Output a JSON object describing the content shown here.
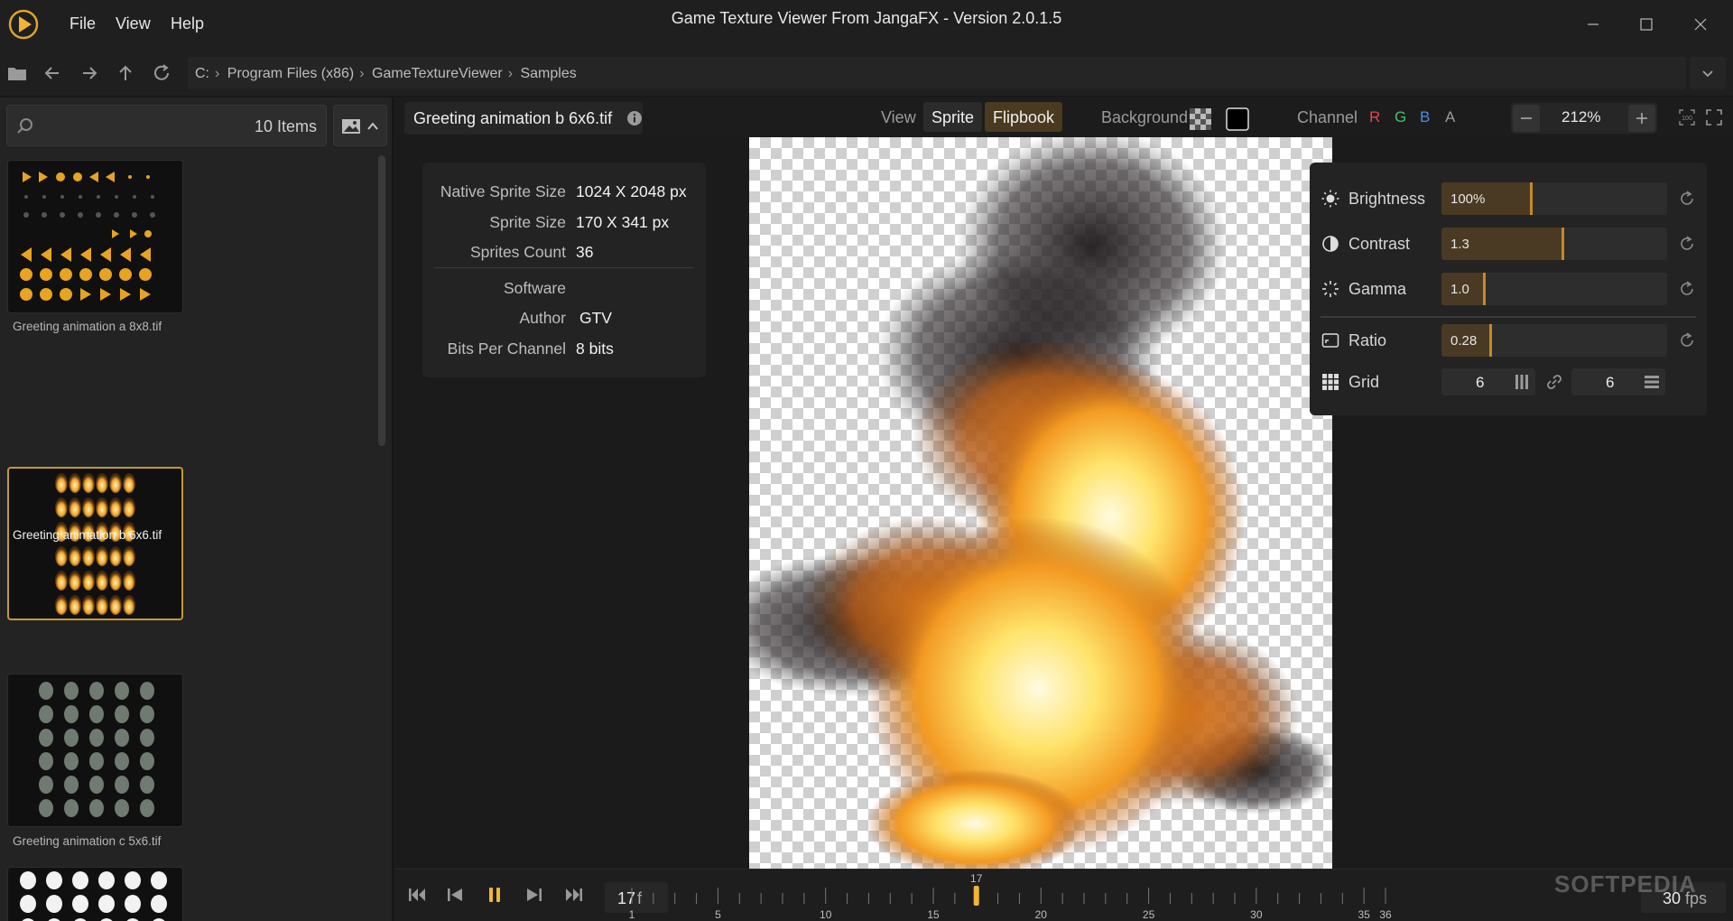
{
  "app": {
    "title": "Game Texture Viewer From JangaFX - Version 2.0.1.5",
    "menu": [
      "File",
      "View",
      "Help"
    ]
  },
  "path": {
    "crumbs": [
      "C:",
      "Program Files (x86)",
      "GameTextureViewer",
      "Samples"
    ]
  },
  "sidebar": {
    "item_count": "10 Items",
    "items": [
      {
        "label": "Greeting animation a 8x8.tif",
        "selected": false,
        "icon": "arrow-shapes-sheet"
      },
      {
        "label": "Greeting animation b 6x6.tif",
        "selected": true,
        "icon": "fire-sprite-sheet"
      },
      {
        "label": "Greeting animation c 5x6.tif",
        "selected": false,
        "icon": "character-sprite-sheet"
      },
      {
        "label": "",
        "selected": false,
        "icon": "chicken-sprite-sheet"
      }
    ]
  },
  "header": {
    "file_name": "Greeting animation b 6x6.tif",
    "view_label": "View",
    "mode_sprite": "Sprite",
    "mode_flipbook": "Flipbook",
    "background_label": "Background",
    "channel_label": "Channel",
    "channels": [
      "R",
      "G",
      "B",
      "A"
    ],
    "channel_colors": [
      "#e0484a",
      "#43c463",
      "#4a8fe6",
      "#9a9a9a"
    ],
    "zoom": "212%"
  },
  "info": {
    "native_sprite_size_label": "Native Sprite Size",
    "native_sprite_size": "1024 X 2048 px",
    "sprite_size_label": "Sprite Size",
    "sprite_size": "170 X 341 px",
    "sprites_count_label": "Sprites Count",
    "sprites_count": "36",
    "software_label": "Software",
    "software": "",
    "author_label": "Author",
    "author": "GTV",
    "bits_label": "Bits Per Channel",
    "bits": "8 bits"
  },
  "adjust": {
    "brightness_label": "Brightness",
    "brightness": "100%",
    "brightness_level": 0.4,
    "contrast_label": "Contrast",
    "contrast": "1.3",
    "contrast_level": 0.54,
    "gamma_label": "Gamma",
    "gamma": "1.0",
    "gamma_level": 0.19,
    "ratio_label": "Ratio",
    "ratio": "0.28",
    "ratio_level": 0.22,
    "grid_label": "Grid",
    "grid_cols": "6",
    "grid_rows": "6"
  },
  "timeline": {
    "current_frame": "17",
    "frame_unit": "f",
    "marker_label": "17",
    "tick_labels": [
      "1",
      "5",
      "10",
      "15",
      "20",
      "25",
      "30",
      "35",
      "36"
    ],
    "fps": "30",
    "fps_unit": "fps"
  },
  "watermark": "SOFTPEDIA"
}
